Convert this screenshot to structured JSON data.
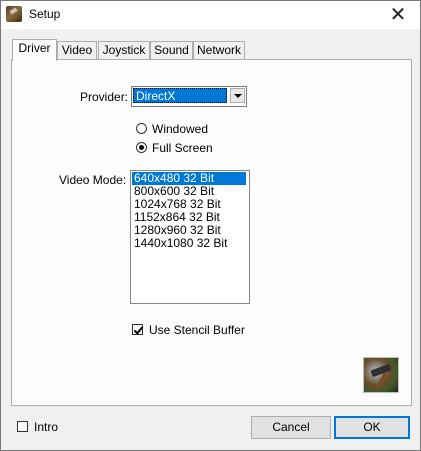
{
  "window": {
    "title": "Setup",
    "close_glyph": "✕"
  },
  "tabs": [
    {
      "label": "Driver",
      "active": true
    },
    {
      "label": "Video",
      "active": false
    },
    {
      "label": "Joystick",
      "active": false
    },
    {
      "label": "Sound",
      "active": false
    },
    {
      "label": "Network",
      "active": false
    }
  ],
  "driver": {
    "provider_label": "Provider:",
    "provider_value": "DirectX",
    "display_options": [
      {
        "label": "Windowed",
        "checked": false
      },
      {
        "label": "Full Screen",
        "checked": true
      }
    ],
    "video_mode_label": "Video Mode:",
    "video_modes": [
      {
        "label": "640x480 32 Bit",
        "selected": true
      },
      {
        "label": "800x600 32 Bit",
        "selected": false
      },
      {
        "label": "1024x768 32 Bit",
        "selected": false
      },
      {
        "label": "1152x864 32 Bit",
        "selected": false
      },
      {
        "label": "1280x960 32 Bit",
        "selected": false
      },
      {
        "label": "1440x1080 32 Bit",
        "selected": false
      }
    ],
    "stencil": {
      "label": "Use Stencil Buffer",
      "checked": true
    }
  },
  "footer": {
    "intro": {
      "label": "Intro",
      "checked": false
    },
    "cancel_label": "Cancel",
    "ok_label": "OK"
  },
  "icons": {
    "app": "app-icon",
    "logo": "game-logo-icon"
  }
}
